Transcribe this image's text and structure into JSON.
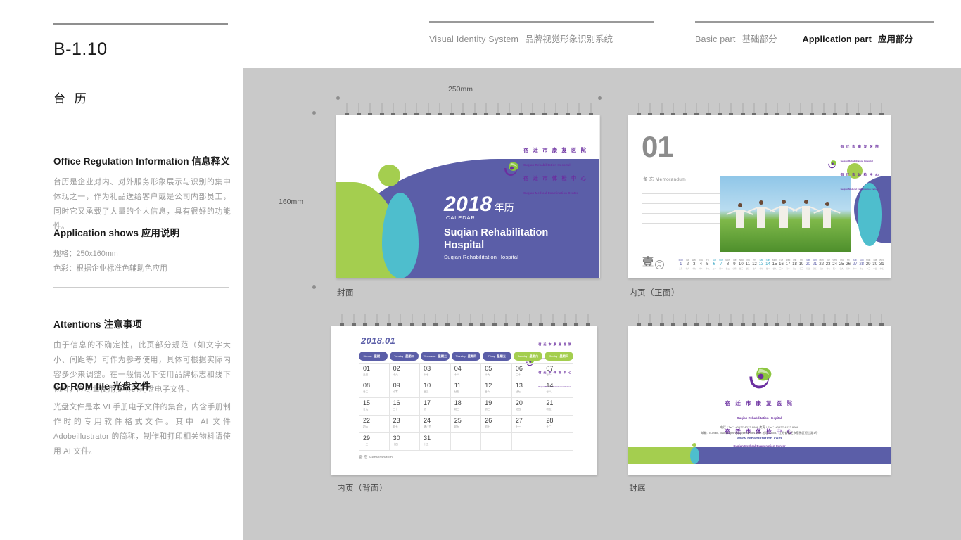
{
  "header": {
    "left_group": {
      "en": "Visual Identity System",
      "cn": "品牌视觉形象识别系统"
    },
    "right_group": [
      {
        "en": "Basic part",
        "cn": "基础部分",
        "active": false
      },
      {
        "en": "Application part",
        "cn": "应用部分",
        "active": true
      }
    ]
  },
  "page": {
    "code": "B-1.10",
    "title": "台 历"
  },
  "sections": {
    "office": {
      "head_en": "Office Regulation Information",
      "head_cn": "信息释义",
      "body": "台历是企业对内、对外服务形象展示与识别的集中体现之一，作为礼品送给客户或是公司内部员工，同时它又承载了大量的个人信息，具有很好的功能性。"
    },
    "application": {
      "head_en": "Application shows",
      "head_cn": "应用说明",
      "line1": "规格：250x160mm",
      "line2": "色彩：根据企业标准色辅助色应用"
    },
    "attentions": {
      "head_en": "Attentions",
      "head_cn": "注意事项",
      "body": "由于信息的不确定性，此页部分规范（如文字大小、间距等）可作为参考使用，具体可根据实际内容多少来调整。在一般情况下使用品牌标志和线下物料，应尽量使用提供的光盘电子文件。"
    },
    "cdrom": {
      "head_en": "CD-ROM file",
      "head_cn": "光盘文件",
      "body": "光盘文件是本 VI 手册电子文件的集合，内含手册制作时的专用软件格式文件。其中 AI 文件 Adobeillustrator 的简称，制作和打印相关物料请使用 AI 文件。"
    }
  },
  "dimensions": {
    "width": "250mm",
    "height": "160mm"
  },
  "brand": {
    "green": "#a4ce4f",
    "teal": "#4ebecd",
    "purple": "#5b5ea8",
    "logo_purple": "#6b2fa0",
    "logo_cn_line1": "宿 迁 市 康 复 医 院",
    "logo_en_line1": "Suqian Rehabilitation Hospital",
    "logo_cn_line2": "宿 迁 市 体 检 中 心",
    "logo_en_line2": "Suqian Medical Examination Center"
  },
  "mockups": {
    "cover": {
      "caption": "封面",
      "year": "2018",
      "year_cn": "年历",
      "caledar": "CALEDAR",
      "name": "Suqian Rehabilitation Hospital",
      "sub": "Suqian Rehabilitation Hospital"
    },
    "inner_front": {
      "caption": "内页（正面）",
      "month_number": "01",
      "memo": "备 忘 Memorandum",
      "seal_cn": "壹",
      "seal_yue": "月"
    },
    "inner_back": {
      "caption": "内页（背面）",
      "title": "2018.01",
      "memo": "备 忘 Memorandum"
    },
    "back_cover": {
      "caption": "封底",
      "tel": "电话 / Tel：+0527-4212 9999    传真 / Fax：+0527-4212 9999",
      "email": "邮箱 / E-mail：daiyongming@jqsecurities.com    地址 / Add：江苏省宿迁市宿豫区恒山路1号",
      "web": "www.rehabilitation.com"
    }
  },
  "chart_data": {
    "type": "table",
    "title": "2018.01",
    "weekdays": [
      {
        "en": "Monday",
        "cn": "星期一",
        "weekend": false
      },
      {
        "en": "Tuesday",
        "cn": "星期二",
        "weekend": false
      },
      {
        "en": "Wednesday",
        "cn": "星期三",
        "weekend": false
      },
      {
        "en": "Thursday",
        "cn": "星期四",
        "weekend": false
      },
      {
        "en": "Friday",
        "cn": "星期五",
        "weekend": false
      },
      {
        "en": "Saturday",
        "cn": "星期六",
        "weekend": true
      },
      {
        "en": "Sunday",
        "cn": "星期天",
        "weekend": true
      }
    ],
    "days": [
      {
        "d": "01",
        "l": "元旦"
      },
      {
        "d": "02",
        "l": "十六"
      },
      {
        "d": "03",
        "l": "十七"
      },
      {
        "d": "04",
        "l": "十八"
      },
      {
        "d": "05",
        "l": "十九"
      },
      {
        "d": "06",
        "l": "二十"
      },
      {
        "d": "07",
        "l": "廿一"
      },
      {
        "d": "08",
        "l": "廿二"
      },
      {
        "d": "09",
        "l": "小寒"
      },
      {
        "d": "10",
        "l": "廿三"
      },
      {
        "d": "11",
        "l": "廿五"
      },
      {
        "d": "12",
        "l": "廿六"
      },
      {
        "d": "13",
        "l": "廿七"
      },
      {
        "d": "14",
        "l": "廿八"
      },
      {
        "d": "15",
        "l": "廿九"
      },
      {
        "d": "16",
        "l": "三十"
      },
      {
        "d": "17",
        "l": "初一"
      },
      {
        "d": "18",
        "l": "初二"
      },
      {
        "d": "19",
        "l": "初三"
      },
      {
        "d": "20",
        "l": "初四"
      },
      {
        "d": "21",
        "l": "初五"
      },
      {
        "d": "22",
        "l": "初六"
      },
      {
        "d": "23",
        "l": "初七"
      },
      {
        "d": "24",
        "l": "腊八节"
      },
      {
        "d": "25",
        "l": "初九"
      },
      {
        "d": "26",
        "l": "初十"
      },
      {
        "d": "27",
        "l": "十一"
      },
      {
        "d": "28",
        "l": "十二"
      },
      {
        "d": "29",
        "l": "十三"
      },
      {
        "d": "30",
        "l": "十四"
      },
      {
        "d": "31",
        "l": "十五"
      }
    ],
    "strip": [
      {
        "dow": "Mon",
        "d": "1",
        "l": "元旦",
        "type": "sun"
      },
      {
        "dow": "Tue",
        "d": "2",
        "l": "十六",
        "type": ""
      },
      {
        "dow": "Wed",
        "d": "3",
        "l": "十七",
        "type": ""
      },
      {
        "dow": "Thu",
        "d": "4",
        "l": "十八",
        "type": ""
      },
      {
        "dow": "Fri",
        "d": "5",
        "l": "十九",
        "type": ""
      },
      {
        "dow": "Sat",
        "d": "6",
        "l": "二十",
        "type": "sat"
      },
      {
        "dow": "Sun",
        "d": "7",
        "l": "廿一",
        "type": "sat"
      },
      {
        "dow": "Mon",
        "d": "8",
        "l": "廿二",
        "type": ""
      },
      {
        "dow": "Tue",
        "d": "9",
        "l": "小寒",
        "type": ""
      },
      {
        "dow": "Wed",
        "d": "10",
        "l": "廿三",
        "type": ""
      },
      {
        "dow": "Thu",
        "d": "11",
        "l": "廿五",
        "type": ""
      },
      {
        "dow": "Fri",
        "d": "12",
        "l": "廿六",
        "type": ""
      },
      {
        "dow": "Sat",
        "d": "13",
        "l": "廿七",
        "type": "sat"
      },
      {
        "dow": "Sun",
        "d": "14",
        "l": "廿八",
        "type": "sat"
      },
      {
        "dow": "Mon",
        "d": "15",
        "l": "廿九",
        "type": ""
      },
      {
        "dow": "Tue",
        "d": "16",
        "l": "三十",
        "type": ""
      },
      {
        "dow": "Wed",
        "d": "17",
        "l": "初一",
        "type": ""
      },
      {
        "dow": "Thu",
        "d": "18",
        "l": "初二",
        "type": ""
      },
      {
        "dow": "Fri",
        "d": "19",
        "l": "初三",
        "type": ""
      },
      {
        "dow": "Sat",
        "d": "20",
        "l": "初四",
        "type": "sun"
      },
      {
        "dow": "Sun",
        "d": "21",
        "l": "初五",
        "type": "sun"
      },
      {
        "dow": "Mon",
        "d": "22",
        "l": "初六",
        "type": ""
      },
      {
        "dow": "Tue",
        "d": "23",
        "l": "初七",
        "type": ""
      },
      {
        "dow": "Wed",
        "d": "24",
        "l": "腊八",
        "type": ""
      },
      {
        "dow": "Thu",
        "d": "25",
        "l": "初九",
        "type": ""
      },
      {
        "dow": "Fri",
        "d": "26",
        "l": "初十",
        "type": ""
      },
      {
        "dow": "Sat",
        "d": "27",
        "l": "十一",
        "type": "sun"
      },
      {
        "dow": "Sun",
        "d": "28",
        "l": "十二",
        "type": "sun"
      },
      {
        "dow": "Mon",
        "d": "29",
        "l": "十三",
        "type": ""
      },
      {
        "dow": "Tue",
        "d": "30",
        "l": "十四",
        "type": ""
      },
      {
        "dow": "Wed",
        "d": "31",
        "l": "十五",
        "type": ""
      }
    ]
  }
}
